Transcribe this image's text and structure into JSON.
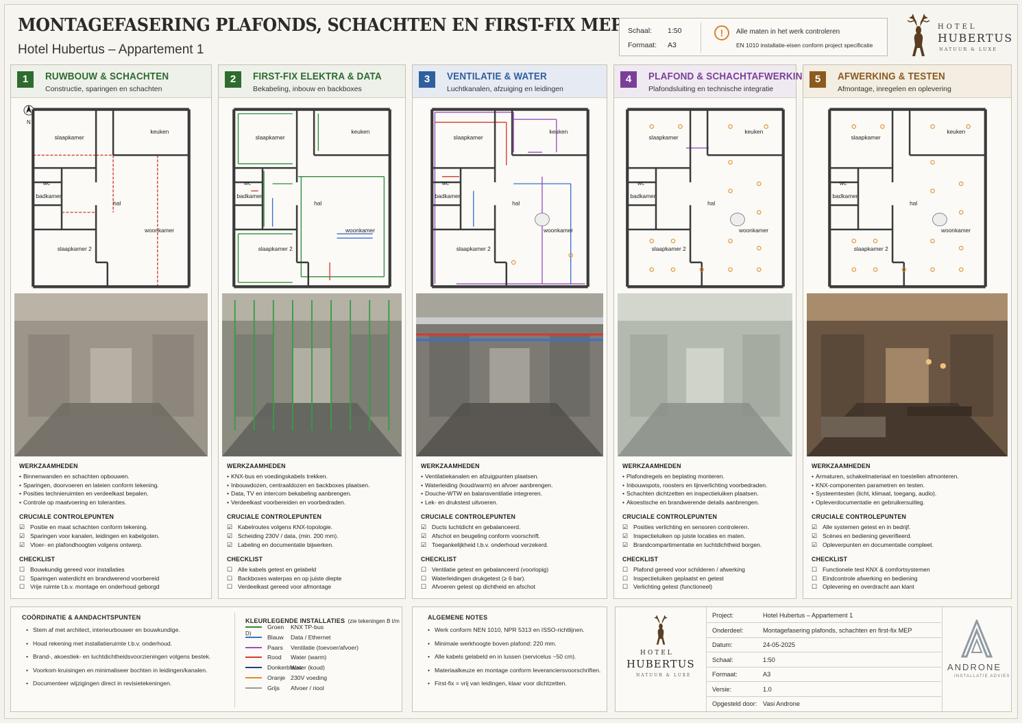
{
  "header": {
    "title": "MONTAGEFASERING PLAFONDS, SCHACHTEN EN FIRST-FIX MEP",
    "subtitle": "Hotel Hubertus – Appartement 1",
    "scale_label": "Schaal:",
    "scale_value": "1:50",
    "format_label": "Formaat:",
    "format_value": "A3",
    "warn_1": "Alle maten in het werk controleren",
    "warn_2": "EN 1010 installatie-eisen conform project specificatie"
  },
  "logo": {
    "line1": "HOTEL",
    "line2": "HUBERTUS",
    "line3": "NATUUR & LUXE"
  },
  "plan_labels": {
    "north": "N",
    "slaapkamer": "slaapkamer",
    "keuken": "keuken",
    "wc": "wc",
    "badkamer": "badkamer",
    "hal": "hal",
    "woonkamer": "woonkamer",
    "slaapkamer2": "slaapkamer 2"
  },
  "section_labels": {
    "werk": "WERKZAAMHEDEN",
    "crucial": "CRUCIALE CONTROLEPUNTEN",
    "check": "CHECKLIST"
  },
  "phases": [
    {
      "num": "1",
      "title": "RUWBOUW & SCHACHTEN",
      "subtitle": "Constructie, sparingen en schachten",
      "color": "#2e6b2f",
      "title_color": "#2e6b2f",
      "header_bg": "#eef0ea",
      "werk": [
        "Binnenwanden en schachten opbouwen.",
        "Sparingen, doorvoeren en lateien conform tekening.",
        "Posities technieruimten en verdeelkast bepalen.",
        "Controle op maatvoering en toleranties."
      ],
      "crucial": [
        "Positie en maat schachten conform tekening.",
        "Sparingen voor kanalen, leidingen en kabelgoten.",
        "Vloer- en plafondhoogten volgens ontwerp."
      ],
      "check": [
        "Bouwkundig gereed voor installaties",
        "Sparingen waterdicht en brandwerend voorbereid",
        "Vrije ruimte t.b.v. montage en onderhoud geborgd"
      ]
    },
    {
      "num": "2",
      "title": "FIRST-FIX ELEKTRA & DATA",
      "subtitle": "Bekabeling, inbouw en backboxes",
      "color": "#2e6b2f",
      "title_color": "#2e6b2f",
      "header_bg": "#eef0ea",
      "werk": [
        "KNX-bus en voedingskabels trekken.",
        "Inbouwdozen, centraaldozen en backboxes plaatsen.",
        "Data, TV en intercom bekabeling aanbrengen.",
        "Verdeelkast voorbereiden en voorbedraden."
      ],
      "crucial": [
        "Kabelroutes volgens KNX-topologie.",
        "Scheiding 230V / data, (min. 200 mm).",
        "Labeling en documentatie bijwerken."
      ],
      "check": [
        "Alle kabels getest en gelabeld",
        "Backboxes waterpas en op juiste diepte",
        "Verdeelkast gereed voor afmontage"
      ]
    },
    {
      "num": "3",
      "title": "VENTILATIE & WATER",
      "subtitle": "Luchtkanalen, afzuiging en leidingen",
      "color": "#2f5f9e",
      "title_color": "#2f5f9e",
      "header_bg": "#e6eaf2",
      "werk": [
        "Ventilatiekanalen en afzuigpunten plaatsen.",
        "Waterleiding (koud/warm) en afvoer aanbrengen.",
        "Douche-WTW en balansventilatie integreren.",
        "Lek- en drukstest uitvoeren."
      ],
      "crucial": [
        "Ducts luchtdicht en gebalanceerd.",
        "Afschot en beugeling conform voorschrift.",
        "Toegankelijkheid t.b.v. onderhoud verzekerd."
      ],
      "check": [
        "Ventilatie getest en gebalanceerd (voorlopig)",
        "Waterleidingen drukgetest (≥ 6 bar).",
        "Afvoeren getest op dichtheid en afschot"
      ]
    },
    {
      "num": "4",
      "title": "PLAFOND & SCHACHTAFWERKING",
      "subtitle": "Plafondsluiting en technische integratie",
      "color": "#7b3f98",
      "title_color": "#7b3f98",
      "header_bg": "#efe9f1",
      "werk": [
        "Plafondregels en beplating monteren.",
        "Inbouwspots, roosters en lijnverlichting voorbedraden.",
        "Schachten dichtzetten en inspectieluiken plaatsen.",
        "Akoestische en brandwerende details aanbrengen."
      ],
      "crucial": [
        "Posities verlichting en sensoren controleren.",
        "Inspectieluiken op juiste locaties en maten.",
        "Brandcompartimentatie en luchtdichtheid borgen."
      ],
      "check": [
        "Plafond gereed voor schilderen / afwerking",
        "Inspectieluiken geplaatst en getest",
        "Verlichting getest (functioneel)"
      ]
    },
    {
      "num": "5",
      "title": "AFWERKING & TESTEN",
      "subtitle": "Afmontage, inregelen en oplevering",
      "color": "#8a5a1e",
      "title_color": "#8a5a1e",
      "header_bg": "#f3ede2",
      "werk": [
        "Armaturen, schakelmateriaal en toestellen afmonteren.",
        "KNX-componenten parametren en testen.",
        "Systeemtesten (licht, klimaat, toegang, audio).",
        "Opleverdocumentatie en gebruikersuitleg."
      ],
      "crucial": [
        "Alle systemen getest en in bedrijf.",
        "Scènes en bediening geverifieerd.",
        "Opleverpunten en documentatie compleet."
      ],
      "check": [
        "Functionele test KNX & comfortsystemen",
        "Eindcontrole afwerking en bediening",
        "Oplevering en overdracht aan klant"
      ]
    }
  ],
  "coordination": {
    "title": "COÖRDINATIE & AANDACHTSPUNTEN",
    "items": [
      "Stem af met architect, interieurbouwer en bouwkundige.",
      "Houd rekening met installatieruimte t.b.v. onderhoud.",
      "Brand-, akoestiek- en luchtdichtheidsvoorzieningen volgens bestek.",
      "Voorkom kruisingen en minimaliseer bochten in leidingen/kanalen.",
      "Documenteer wijzigingen direct in revisietekeningen."
    ]
  },
  "legend": {
    "title": "KLEURLEGENDE INSTALLATIES",
    "title_note": "(zie tekeningen B t/m D)",
    "items": [
      {
        "color": "#2e8b3a",
        "name": "Groen",
        "desc": "KNX TP-bus"
      },
      {
        "color": "#3b6fd0",
        "name": "Blauw",
        "desc": "Data / Ethernet"
      },
      {
        "color": "#9b4fc0",
        "name": "Paars",
        "desc": "Ventilatie (toevoer/afvoer)"
      },
      {
        "color": "#d23a32",
        "name": "Rood",
        "desc": "Water (warm)"
      },
      {
        "color": "#1f3f8a",
        "name": "Donkerblauw",
        "desc": "Water (koud)"
      },
      {
        "color": "#e08a2a",
        "name": "Oranje",
        "desc": "230V voeding"
      },
      {
        "color": "#9a9a9a",
        "name": "Grijs",
        "desc": "Afvoer / riool"
      }
    ]
  },
  "notes": {
    "title": "ALGEMENE NOTES",
    "items": [
      "Werk conform NEN 1010, NPR 5313 en ISSO-richtlijnen.",
      "Minimale werkhoogte boven plafond: 220 mm.",
      "Alle kabels gelabeld en in lussen (servicelus ~50 cm).",
      "Materiaalkeuze en montage conform leveranciersvoorschriften.",
      "First-fix = vrij van leidingen, klaar voor dichtzetten."
    ]
  },
  "titleblock": {
    "rows": [
      {
        "k": "Project:",
        "v": "Hotel Hubertus – Appartement 1"
      },
      {
        "k": "Onderdeel:",
        "v": "Montagefasering plafonds, schachten en first-fix MEP"
      },
      {
        "k": "Datum:",
        "v": "24-05-2025"
      },
      {
        "k": "Schaal:",
        "v": "1:50"
      },
      {
        "k": "Formaat:",
        "v": "A3"
      },
      {
        "k": "Versie:",
        "v": "1.0"
      },
      {
        "k": "Opgesteld door:",
        "v": "Vasi Androne"
      }
    ],
    "brand": "ANDRONE",
    "brand_sub": "INSTALLATIE ADVIES"
  }
}
